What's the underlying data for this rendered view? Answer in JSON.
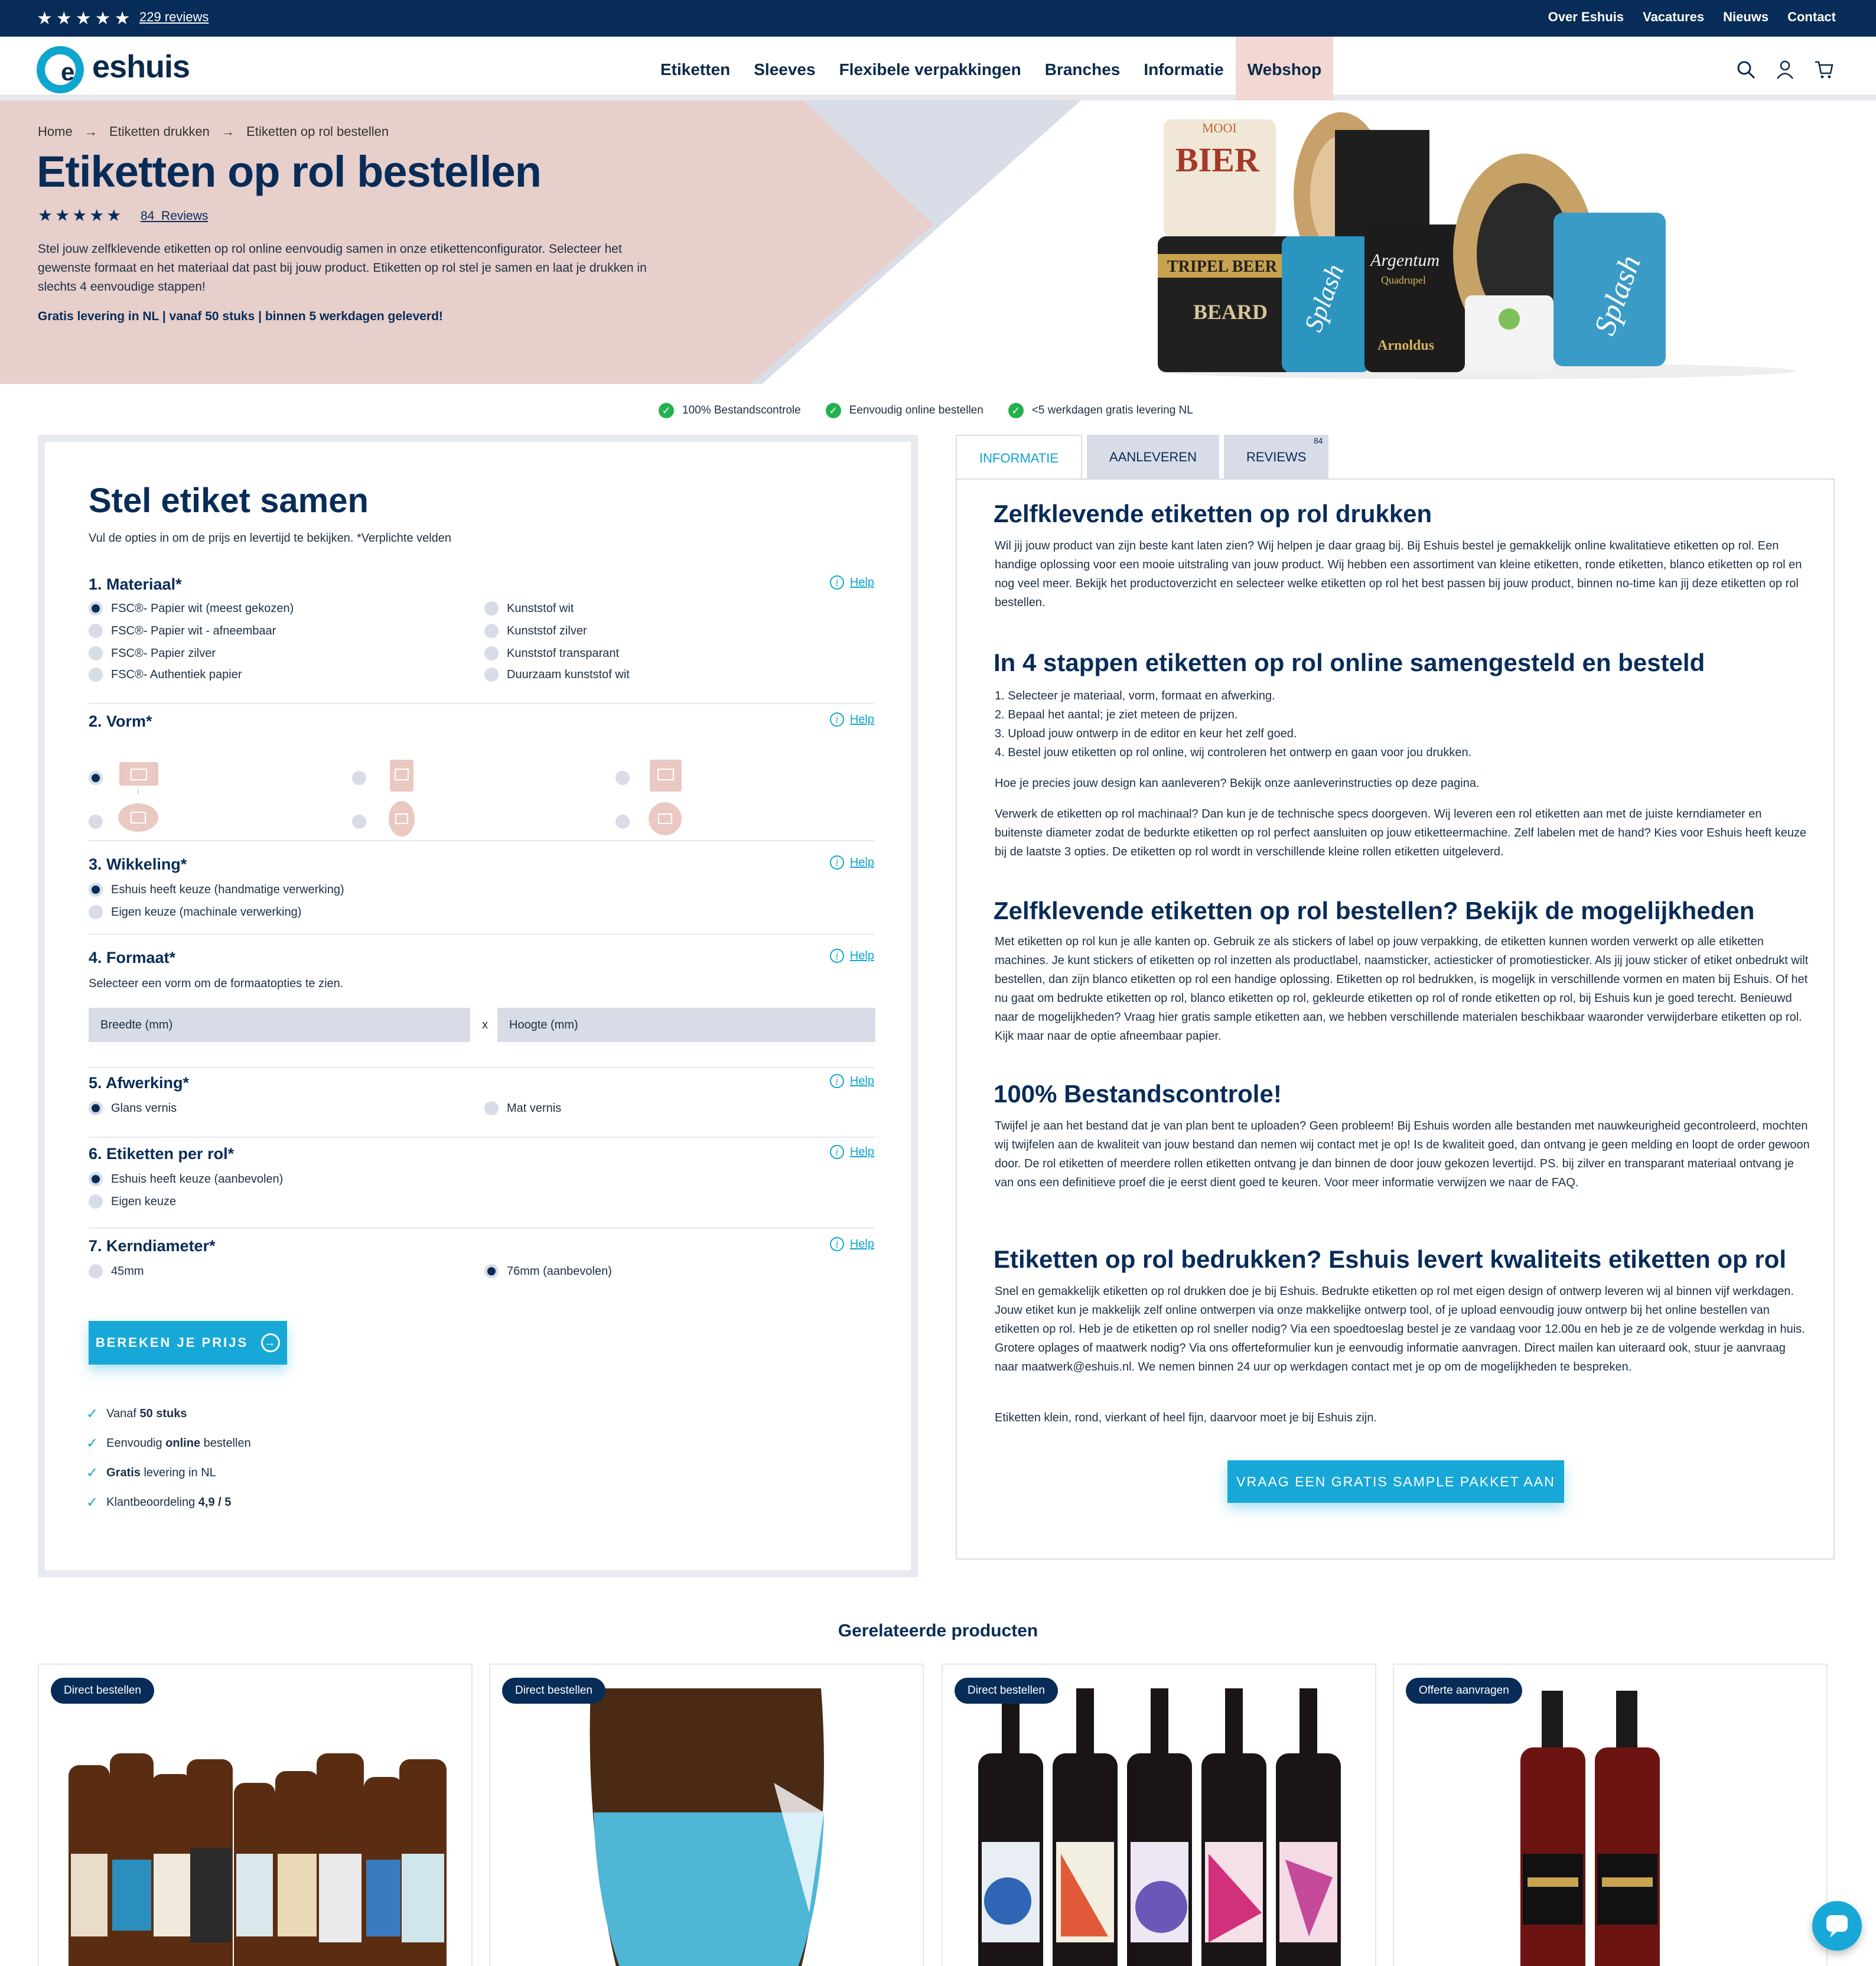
{
  "topbar": {
    "rating_stars": "★★★★★",
    "reviews": "229 reviews",
    "links": [
      "Over Eshuis",
      "Vacatures",
      "Nieuws",
      "Contact"
    ]
  },
  "header": {
    "logo_text": "eshuis",
    "logo_letter": "e",
    "nav": [
      "Etiketten",
      "Sleeves",
      "Flexibele verpakkingen",
      "Branches",
      "Informatie",
      "Webshop"
    ],
    "active_nav": "Webshop",
    "icons": [
      "search-icon",
      "user-icon",
      "cart-icon"
    ]
  },
  "hero": {
    "breadcrumb": [
      "Home",
      "→",
      "Etiketten drukken",
      "→",
      "Etiketten op rol bestellen"
    ],
    "title": "Etiketten op rol bestellen",
    "stars": "★★★★★",
    "reviews_count": "84",
    "reviews_label": "Reviews",
    "description": "Stel jouw zelfklevende etiketten op rol online eenvoudig samen in onze etikettenconfigurator. Selecteer het gewenste formaat en het materiaal dat past bij jouw product. Etiketten op rol stel je samen en laat je drukken in slechts 4 eenvoudige stappen!",
    "note": "Gratis levering in NL | vanaf 50 stuks | binnen 5 werkdagen geleverd!",
    "roll_labels": [
      "MOOI",
      "BIER",
      "TRIPEL BEER",
      "BEARD",
      "Splash",
      "Argentum",
      "Quadrupel",
      "Arnoldus",
      "Splash"
    ]
  },
  "usps": [
    "100% Bestandscontrole",
    "Eenvoudig online bestellen",
    "<5 werkdagen gratis levering NL"
  ],
  "configurator": {
    "title": "Stel etiket samen",
    "subtitle": "Vul de opties in om de prijs en levertijd te bekijken. *Verplichte velden",
    "help": "Help",
    "sections": {
      "materiaal": {
        "title": "1. Materiaal*",
        "left": [
          "FSC®- Papier wit (meest gekozen)",
          "FSC®- Papier wit - afneembaar",
          "FSC®- Papier zilver",
          "FSC®- Authentiek papier"
        ],
        "right": [
          "Kunststof wit",
          "Kunststof zilver",
          "Kunststof transparant",
          "Duurzaam kunststof wit"
        ]
      },
      "vorm": {
        "title": "2. Vorm*"
      },
      "wikkeling": {
        "title": "3. Wikkeling*",
        "options": [
          "Eshuis heeft keuze (handmatige verwerking)",
          "Eigen keuze (machinale verwerking)"
        ]
      },
      "formaat": {
        "title": "4. Formaat*",
        "hint": "Selecteer een vorm om de formaatopties te zien.",
        "width_placeholder": "Breedte (mm)",
        "height_placeholder": "Hoogte (mm)",
        "x": "x"
      },
      "afwerking": {
        "title": "5. Afwerking*",
        "options": [
          "Glans vernis",
          "Mat vernis"
        ]
      },
      "per_rol": {
        "title": "6. Etiketten per rol*",
        "options": [
          "Eshuis heeft keuze (aanbevolen)",
          "Eigen keuze"
        ]
      },
      "kern": {
        "title": "7. Kerndiameter*",
        "options": [
          "45mm",
          "76mm (aanbevolen)"
        ]
      }
    },
    "button": "BEREKEN JE PRIJS",
    "bullets": [
      [
        "Vanaf ",
        "50 stuks",
        ""
      ],
      [
        "Eenvoudig ",
        "online",
        " bestellen"
      ],
      [
        "",
        "Gratis",
        " levering in NL"
      ],
      [
        "Klantbeoordeling ",
        "4,9 / 5",
        ""
      ]
    ]
  },
  "tabs": {
    "items": [
      "INFORMATIE",
      "AANLEVEREN",
      "REVIEWS"
    ],
    "reviews_badge": "84",
    "active": "INFORMATIE"
  },
  "info": {
    "h1": "Zelfklevende etiketten op rol drukken",
    "p1": "Wil jij jouw product van zijn beste kant laten zien? Wij helpen je daar graag bij. Bij Eshuis bestel je gemakkelijk online kwalitatieve etiketten op rol. Een handige oplossing voor een mooie uitstraling van jouw product. Wij hebben een assortiment van kleine etiketten, ronde etiketten, blanco etiketten op rol en nog veel meer. Bekijk het productoverzicht en selecteer welke etiketten op rol het best passen bij jouw product, binnen no-time kan jij deze etiketten op rol bestellen.",
    "h2": "In 4 stappen etiketten op rol online samengesteld en besteld",
    "steps": [
      "1. Selecteer je materiaal, vorm, formaat en afwerking.",
      "2. Bepaal het aantal; je ziet meteen de prijzen.",
      "3. Upload jouw ontwerp in de editor en keur het zelf goed.",
      "4. Bestel jouw etiketten op rol online, wij controleren het ontwerp en gaan voor jou drukken."
    ],
    "p2": "Hoe je precies jouw design kan aanleveren? Bekijk onze aanleverinstructies op deze pagina.",
    "p3": "Verwerk de etiketten op rol machinaal? Dan kun je de technische specs doorgeven. Wij leveren een rol etiketten aan met de juiste kerndiameter en buitenste diameter zodat de bedurkte etiketten op rol perfect aansluiten op jouw etiketteermachine. Zelf labelen met de hand? Kies voor Eshuis heeft keuze bij de laatste 3 opties. De etiketten op rol wordt in verschillende kleine rollen etiketten uitgeleverd.",
    "h3": "Zelfklevende etiketten op rol bestellen? Bekijk de mogelijkheden",
    "p4": "Met etiketten op rol kun je alle kanten op. Gebruik ze als stickers of label op jouw verpakking, de etiketten kunnen worden verwerkt op alle etiketten machines. Je kunt stickers of etiketten op rol inzetten als productlabel, naamsticker, actiesticker of promotiesticker. Als jij jouw sticker of etiket onbedrukt wilt bestellen, dan zijn blanco etiketten op rol een handige oplossing. Etiketten op rol bedrukken, is mogelijk in verschillende vormen en maten bij Eshuis. Of het nu gaat om bedrukte etiketten op rol, blanco etiketten op rol, gekleurde etiketten op rol of ronde etiketten op rol, bij Eshuis kun je goed terecht. Benieuwd naar de mogelijkheden? Vraag hier gratis sample etiketten aan, we hebben verschillende materialen beschikbaar waaronder verwijderbare etiketten op rol. Kijk maar naar de optie afneembaar papier.",
    "h4": "100% Bestandscontrole!",
    "p5": "Twijfel je aan het bestand dat je van plan bent te uploaden? Geen probleem! Bij Eshuis worden alle bestanden met nauwkeurigheid gecontroleerd, mochten wij twijfelen aan de kwaliteit van jouw bestand dan nemen wij contact met je op! Is de kwaliteit goed, dan ontvang je geen melding en loopt de order gewoon door. De rol etiketten of meerdere rollen etiketten ontvang je dan binnen de door jouw gekozen levertijd. PS. bij zilver en transparant materiaal ontvang je van ons een definitieve proef die je eerst dient goed te keuren. Voor meer informatie verwijzen we naar de FAQ.",
    "h5": "Etiketten op rol bedrukken? Eshuis levert kwaliteits etiketten op rol",
    "p6": "Snel en gemakkelijk etiketten op rol drukken doe je bij Eshuis. Bedrukte etiketten op rol met eigen design of ontwerp leveren wij al binnen vijf werkdagen. Jouw etiket kun je makkelijk zelf online ontwerpen via onze makkelijke ontwerp tool, of je upload eenvoudig jouw ontwerp bij het online bestellen van etiketten op rol. Heb je de etiketten op rol sneller nodig? Via een spoedtoeslag bestel je ze vandaag voor 12.00u en heb je ze de volgende werkdag in huis. Grotere oplages of maatwerk nodig? Via ons offerteformulier kun je eenvoudig informatie aanvragen. Direct mailen kan uiteraard ook, stuur je aanvraag naar maatwerk@eshuis.nl. We nemen binnen 24 uur op werkdagen contact met je op om de mogelijkheden te bespreken.",
    "p7": "Etiketten klein, rond, vierkant of heel fijn, daarvoor moet je bij Eshuis zijn.",
    "button": "VRAAG EEN GRATIS SAMPLE PAKKET AAN"
  },
  "related": {
    "title": "Gerelateerde producten",
    "cards": [
      {
        "badge": "Direct bestellen"
      },
      {
        "badge": "Direct bestellen"
      },
      {
        "badge": "Direct bestellen"
      },
      {
        "badge": "Offerte aanvragen"
      }
    ]
  }
}
